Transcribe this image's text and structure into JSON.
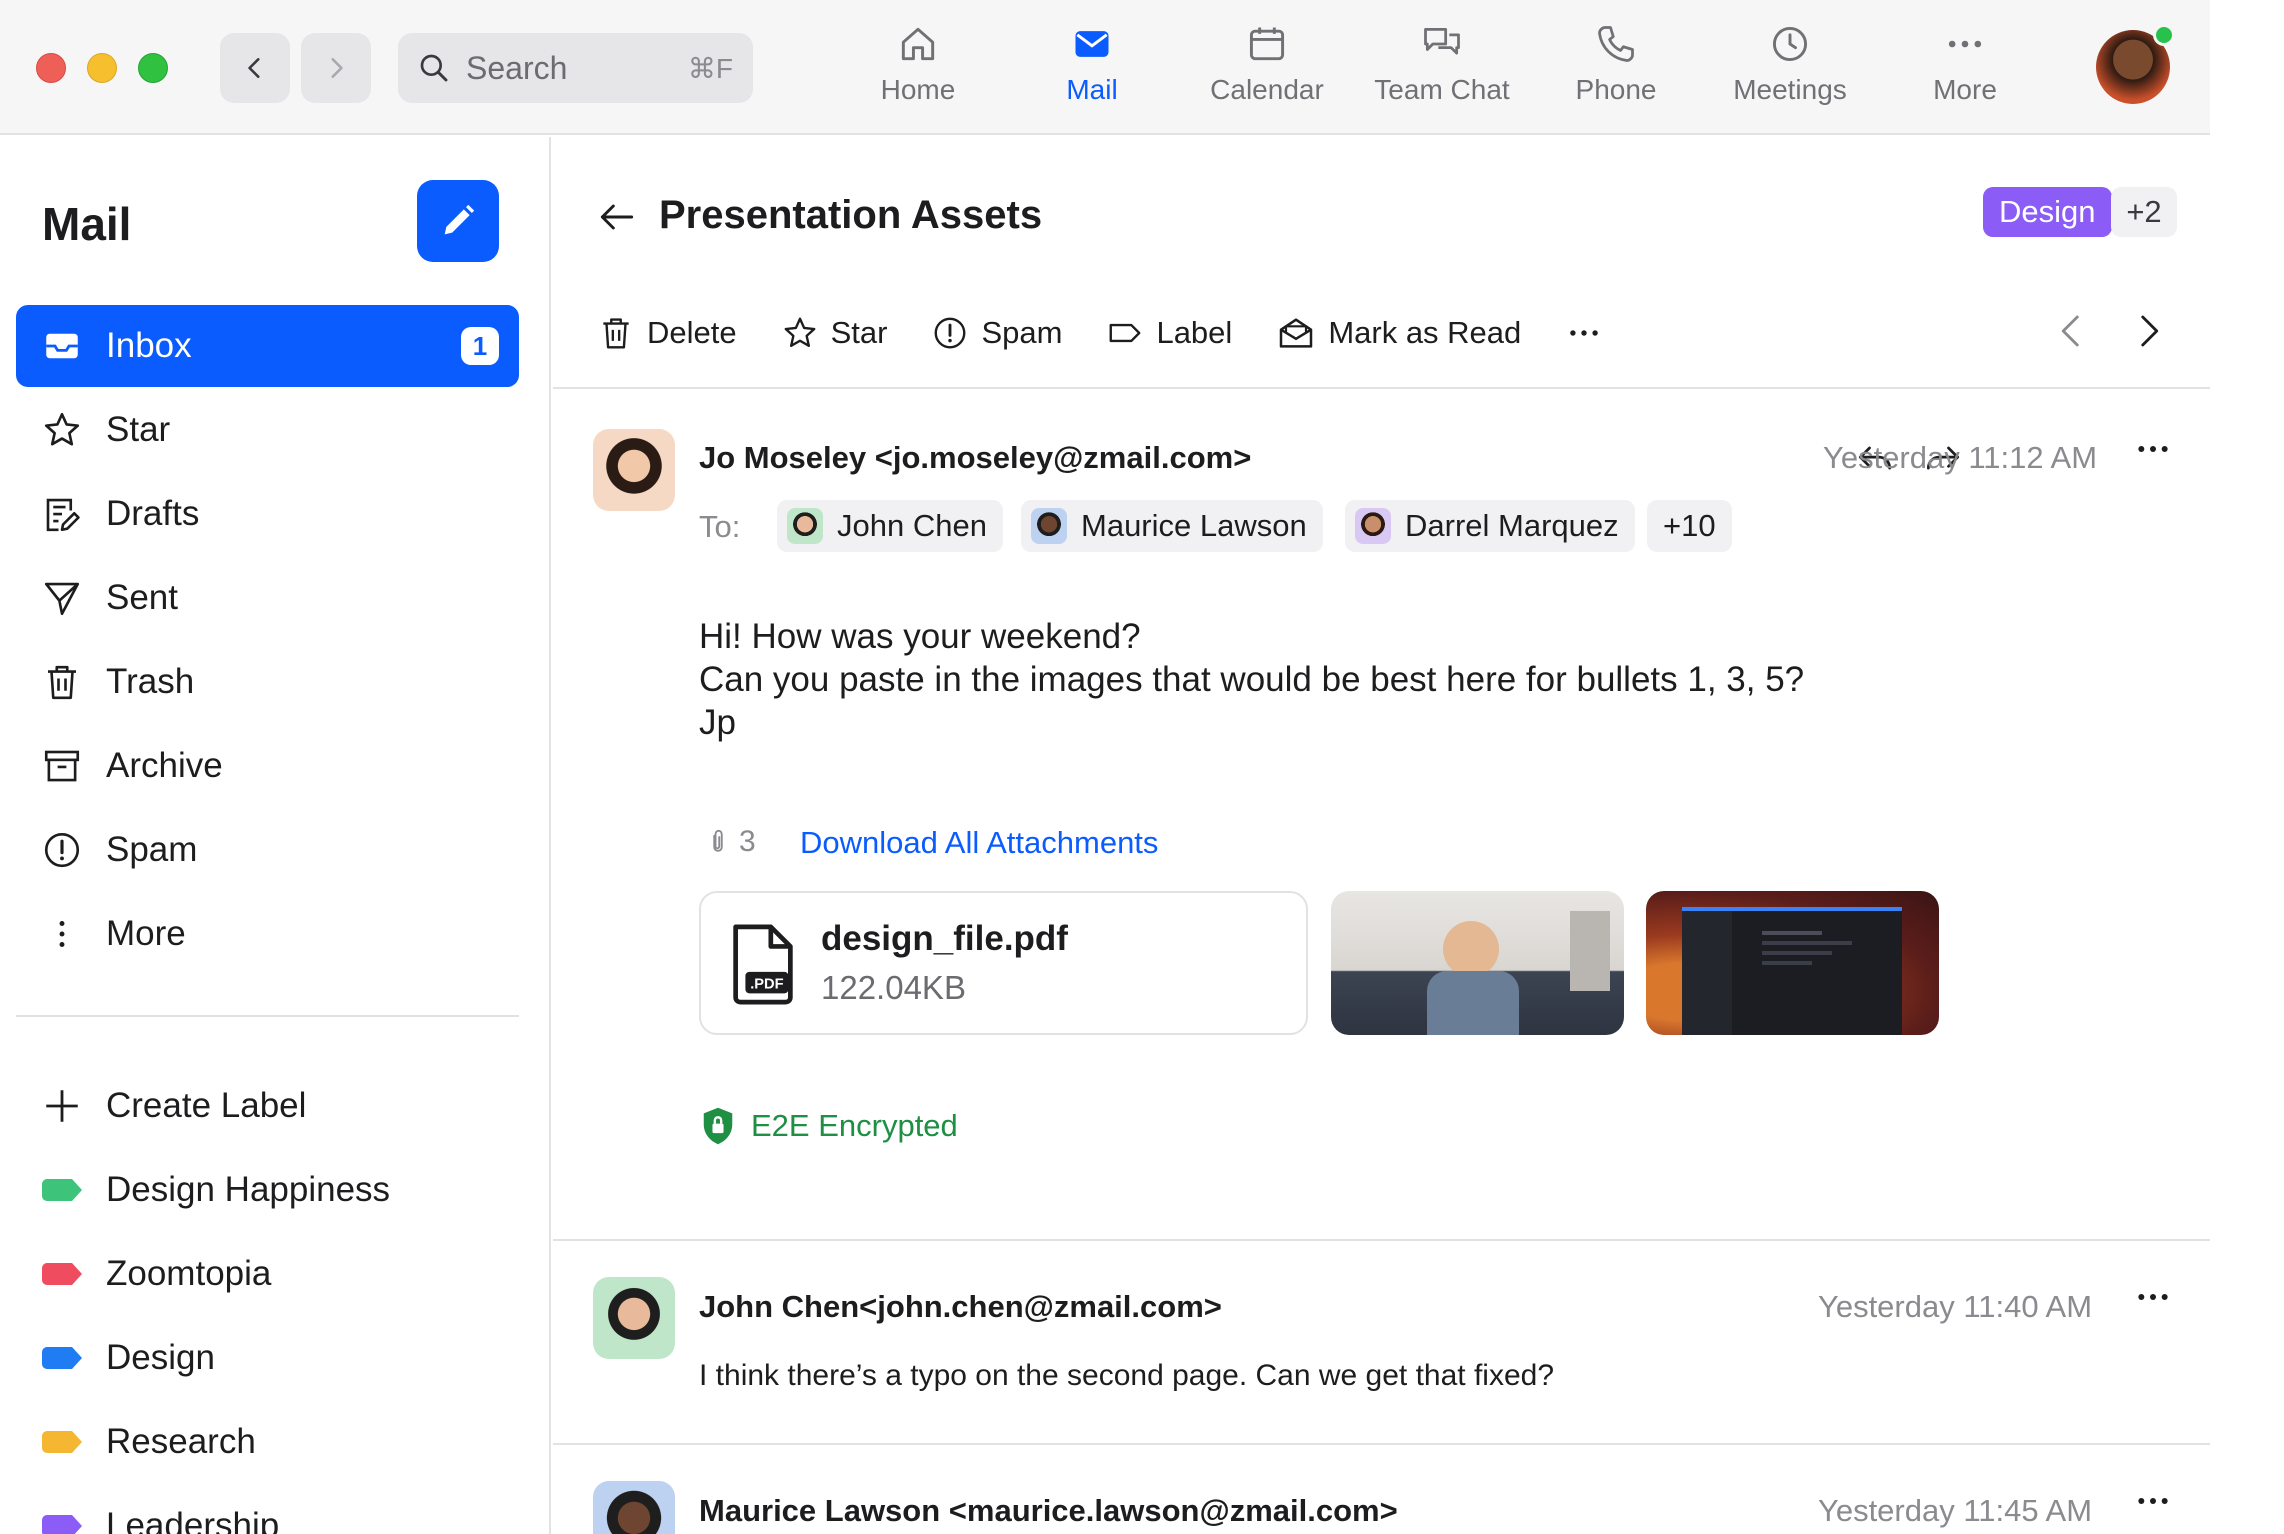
{
  "window": {
    "search_placeholder": "Search",
    "search_shortcut": "⌘F",
    "tabs": [
      {
        "label": "Home",
        "icon": "home-icon"
      },
      {
        "label": "Mail",
        "icon": "mail-icon",
        "active": true
      },
      {
        "label": "Calendar",
        "icon": "calendar-icon"
      },
      {
        "label": "Team Chat",
        "icon": "chat-icon"
      },
      {
        "label": "Phone",
        "icon": "phone-icon"
      },
      {
        "label": "Meetings",
        "icon": "clock-icon"
      },
      {
        "label": "More",
        "icon": "more-icon"
      }
    ]
  },
  "sidebar": {
    "title": "Mail",
    "folders": [
      {
        "label": "Inbox",
        "icon": "inbox-icon",
        "badge": "1",
        "active": true
      },
      {
        "label": "Star",
        "icon": "star-icon"
      },
      {
        "label": "Drafts",
        "icon": "drafts-icon"
      },
      {
        "label": "Sent",
        "icon": "sent-icon"
      },
      {
        "label": "Trash",
        "icon": "trash-icon"
      },
      {
        "label": "Archive",
        "icon": "archive-icon"
      },
      {
        "label": "Spam",
        "icon": "spam-icon"
      },
      {
        "label": "More",
        "icon": "vertical-dots-icon"
      }
    ],
    "create_label": "Create Label",
    "labels": [
      {
        "label": "Design Happiness",
        "color": "#3ec37a"
      },
      {
        "label": "Zoomtopia",
        "color": "#ef4d5f"
      },
      {
        "label": "Design",
        "color": "#1f7cf2"
      },
      {
        "label": "Research",
        "color": "#f5b731"
      },
      {
        "label": "Leadership",
        "color": "#8b5cf6"
      }
    ]
  },
  "thread": {
    "subject": "Presentation Assets",
    "tag": "Design",
    "tag_color": "#8b5cf6",
    "tag_more": "+2",
    "toolbar": {
      "delete": "Delete",
      "star": "Star",
      "spam": "Spam",
      "label": "Label",
      "mark_read": "Mark as Read"
    },
    "messages": [
      {
        "from": "Jo Moseley <jo.moseley@zmail.com>",
        "time": "Yesterday 11:12 AM",
        "to_label": "To:",
        "recipients": [
          "John Chen",
          "Maurice Lawson",
          "Darrel Marquez"
        ],
        "recipients_more": "+10",
        "body": [
          "Hi! How was your weekend?",
          "Can you paste in the images that would be best here for bullets 1, 3, 5?",
          "Jp"
        ],
        "attachment_count": "3",
        "download_all": "Download All Attachments",
        "file": {
          "name": "design_file.pdf",
          "size": "122.04KB",
          "ext": ".PDF"
        },
        "encryption": "E2E Encrypted"
      },
      {
        "from": "John Chen<john.chen@zmail.com>",
        "time": "Yesterday 11:40 AM",
        "body": "I think there’s a typo on the second page. Can we get that fixed?"
      },
      {
        "from": "Maurice Lawson <maurice.lawson@zmail.com>",
        "time": "Yesterday 11:45 AM"
      }
    ]
  },
  "colors": {
    "accent": "#0b5cff",
    "encrypted": "#1e8f43",
    "online": "#27c24c"
  }
}
